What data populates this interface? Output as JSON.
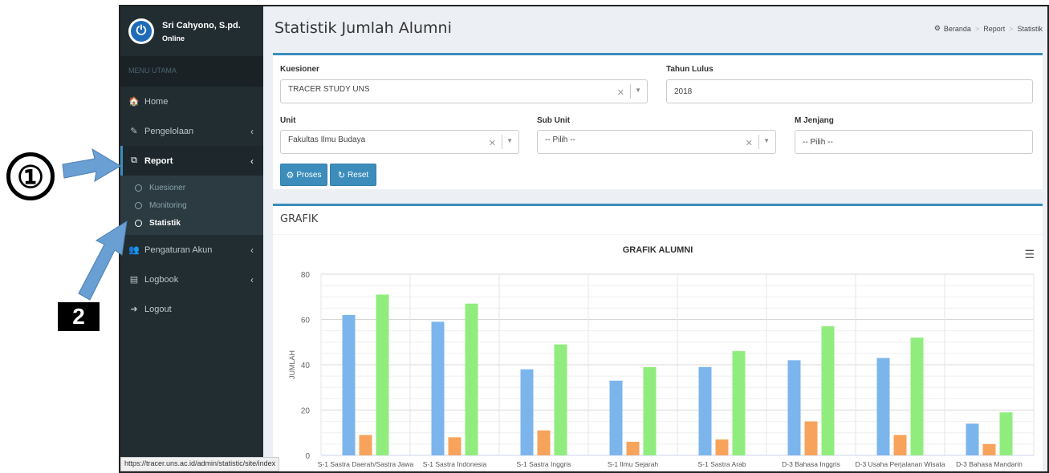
{
  "callouts": {
    "one": "①",
    "two": "2"
  },
  "user": {
    "name": "Sri Cahyono, S.pd.",
    "status": "Online"
  },
  "menu": {
    "header": "MENU UTAMA",
    "items": [
      {
        "label": "Home",
        "icon": "home-icon",
        "glyph": "🏠"
      },
      {
        "label": "Pengelolaan",
        "icon": "pencil-icon",
        "glyph": "✎"
      },
      {
        "label": "Report",
        "icon": "copy-icon",
        "glyph": "⧉"
      },
      {
        "label": "Pengaturan Akun",
        "icon": "users-icon",
        "glyph": "👥"
      },
      {
        "label": "Logbook",
        "icon": "book-icon",
        "glyph": "▤"
      },
      {
        "label": "Logout",
        "icon": "sign-out-icon",
        "glyph": "➜"
      }
    ],
    "submenu": [
      "Kuesioner",
      "Monitoring",
      "Statistik"
    ]
  },
  "page": {
    "title": "Statistik Jumlah Alumni",
    "breadcrumb": [
      "Beranda",
      "Report",
      "Statistik"
    ]
  },
  "form": {
    "kuesioner_label": "Kuesioner",
    "kuesioner_value": "TRACER STUDY UNS",
    "tahun_label": "Tahun Lulus",
    "tahun_value": "2018",
    "unit_label": "Unit",
    "unit_value": "Fakultas Ilmu Budaya",
    "subunit_label": "Sub Unit",
    "subunit_value": "-- Pilih --",
    "jenjang_label": "M Jenjang",
    "jenjang_value": "-- Pilih --",
    "proses_label": "Proses",
    "reset_label": "Reset"
  },
  "chart_box": {
    "title": "GRAFIK"
  },
  "status_url": "https://tracer.uns.ac.id/admin/statistic/site/index",
  "colors": {
    "series1": "#7cb5ec",
    "series2": "#f7a35c",
    "series3": "#90ed7d",
    "accent": "#3c8dbc",
    "sidebar": "#222d32"
  },
  "chart_data": {
    "type": "bar",
    "title": "GRAFIK ALUMNI",
    "ylabel": "JUMLAH",
    "ylim": [
      0,
      80
    ],
    "yticks": [
      0,
      20,
      40,
      60,
      80
    ],
    "categories": [
      "S-1 Sastra Daerah/Sastra Jawa",
      "S-1 Sastra Indonesia",
      "S-1 Sastra Inggris",
      "S-1 Ilmu Sejarah",
      "S-1 Sastra Arab",
      "D-3 Bahasa Inggris",
      "D-3 Usaha Perjalanan Wisata",
      "D-3 Bahasa Mandarin"
    ],
    "series": [
      {
        "values": [
          62,
          59,
          38,
          33,
          39,
          42,
          43,
          14
        ]
      },
      {
        "values": [
          9,
          8,
          11,
          6,
          7,
          15,
          9,
          5
        ]
      },
      {
        "values": [
          71,
          67,
          49,
          39,
          46,
          57,
          52,
          19
        ]
      }
    ]
  }
}
